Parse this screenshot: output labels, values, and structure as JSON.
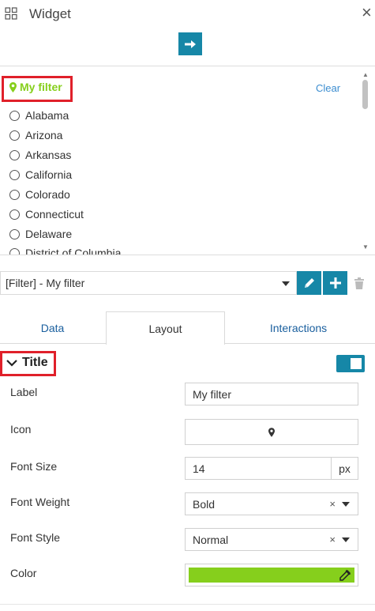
{
  "header": {
    "title": "Widget",
    "widget_icon": "grid-icon",
    "close_label": "×",
    "arrow_icon": "arrow-right-icon"
  },
  "preview": {
    "filter_title": "My filter",
    "title_icon": "map-pin-icon",
    "title_color": "#86cf1c",
    "clear_label": "Clear",
    "options": [
      "Alabama",
      "Arizona",
      "Arkansas",
      "California",
      "Colorado",
      "Connecticut",
      "Delaware",
      "District of Columbia"
    ]
  },
  "filter_select": {
    "value": "[Filter] - My filter"
  },
  "tabs": [
    {
      "label": "Data",
      "active": false
    },
    {
      "label": "Layout",
      "active": true
    },
    {
      "label": "Interactions",
      "active": false
    }
  ],
  "section": {
    "title": "Title",
    "enabled": true
  },
  "form": {
    "label": {
      "label": "Label",
      "value": "My filter"
    },
    "icon": {
      "label": "Icon",
      "icon": "map-pin-icon"
    },
    "font_size": {
      "label": "Font Size",
      "value": "14",
      "unit": "px"
    },
    "font_weight": {
      "label": "Font Weight",
      "value": "Bold",
      "clear": "×"
    },
    "font_style": {
      "label": "Font Style",
      "value": "Normal",
      "clear": "×"
    },
    "color": {
      "label": "Color",
      "value": "#86cf1c"
    }
  },
  "colors": {
    "accent": "#1687a7",
    "highlight": "#e0202a",
    "filter_green": "#86cf1c",
    "link": "#3b8dd0"
  }
}
